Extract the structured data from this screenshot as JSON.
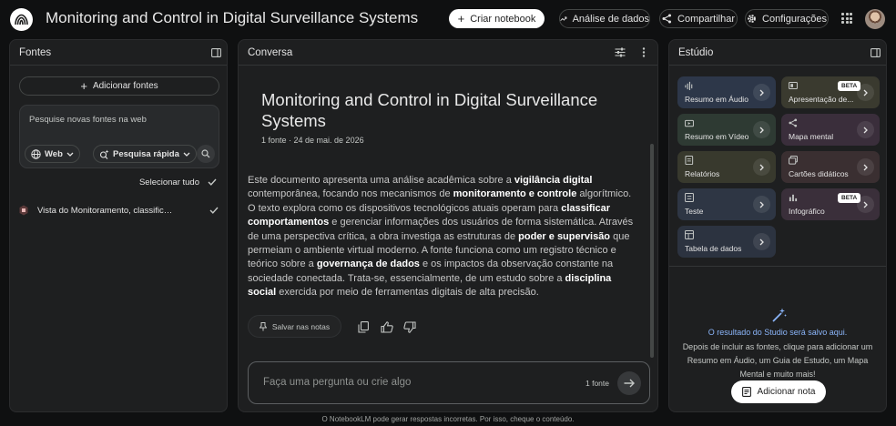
{
  "header": {
    "title": "Monitoring and Control in Digital Surveillance Systems",
    "create_notebook": "Criar notebook",
    "analytics": "Análise de dados",
    "share": "Compartilhar",
    "settings": "Configurações"
  },
  "sources": {
    "title": "Fontes",
    "add_label": "Adicionar fontes",
    "search_placeholder": "Pesquise novas fontes na web",
    "web_chip": "Web",
    "fast_search_chip": "Pesquisa rápida",
    "select_all": "Selecionar tudo",
    "items": [
      {
        "label": "Vista do Monitoramento, classifica...",
        "checked": true
      }
    ]
  },
  "chat": {
    "title": "Conversa",
    "doc_title": "Monitoring and Control in Digital Surveillance Systems",
    "doc_meta": "1 fonte · 24 de mai. de 2026",
    "summary_parts": [
      {
        "t": "Este documento apresenta uma análise acadêmica sobre a ",
        "b": false
      },
      {
        "t": "vigilância digital",
        "b": true
      },
      {
        "t": " contemporânea, focando nos mecanismos de ",
        "b": false
      },
      {
        "t": "monitoramento e controle",
        "b": true
      },
      {
        "t": " algorítmico. O texto explora como os dispositivos tecnológicos atuais operam para ",
        "b": false
      },
      {
        "t": "classificar comportamentos",
        "b": true
      },
      {
        "t": " e gerenciar informações dos usuários de forma sistemática. Através de uma perspectiva crítica, a obra investiga as estruturas de ",
        "b": false
      },
      {
        "t": "poder e supervisão",
        "b": true
      },
      {
        "t": " que permeiam o ambiente virtual moderno. A fonte funciona como um registro técnico e teórico sobre a ",
        "b": false
      },
      {
        "t": "governança de dados",
        "b": true
      },
      {
        "t": " e os impactos da observação constante na sociedade conectada. Trata-se, essencialmente, de um estudo sobre a ",
        "b": false
      },
      {
        "t": "disciplina social",
        "b": true
      },
      {
        "t": " exercida por meio de ferramentas digitais de alta precisão.",
        "b": false
      }
    ],
    "save_note": "Salvar nas notas",
    "input_placeholder": "Faça uma pergunta ou crie algo",
    "source_count": "1 fonte"
  },
  "studio": {
    "title": "Estúdio",
    "cards": [
      {
        "label": "Resumo em Áudio",
        "color": "#2d3749",
        "icon": "audio-icon"
      },
      {
        "label": "Apresentação de...",
        "color": "#3a3a2f",
        "icon": "slides-icon",
        "badge": "BETA"
      },
      {
        "label": "Resumo em Vídeo",
        "color": "#2e3a33",
        "icon": "video-icon"
      },
      {
        "label": "Mapa mental",
        "color": "#3a2e3b",
        "icon": "mindmap-icon"
      },
      {
        "label": "Relatórios",
        "color": "#38392d",
        "icon": "report-icon"
      },
      {
        "label": "Cartões didáticos",
        "color": "#3a2f31",
        "icon": "flashcards-icon"
      },
      {
        "label": "Teste",
        "color": "#2e3644",
        "icon": "quiz-icon"
      },
      {
        "label": "Infográfico",
        "color": "#3a2f3a",
        "icon": "infographic-icon",
        "badge": "BETA"
      },
      {
        "label": "Tabela de dados",
        "color": "#2c3340",
        "icon": "table-icon"
      }
    ],
    "empty_title": "O resultado do Studio será salvo aqui.",
    "empty_text": "Depois de incluir as fontes, clique para adicionar um Resumo em Áudio, um Guia de Estudo, um Mapa Mental e muito mais!",
    "add_note": "Adicionar nota"
  },
  "footer": {
    "disclaimer": "O NotebookLM pode gerar respostas incorretas. Por isso, cheque o conteúdo."
  }
}
